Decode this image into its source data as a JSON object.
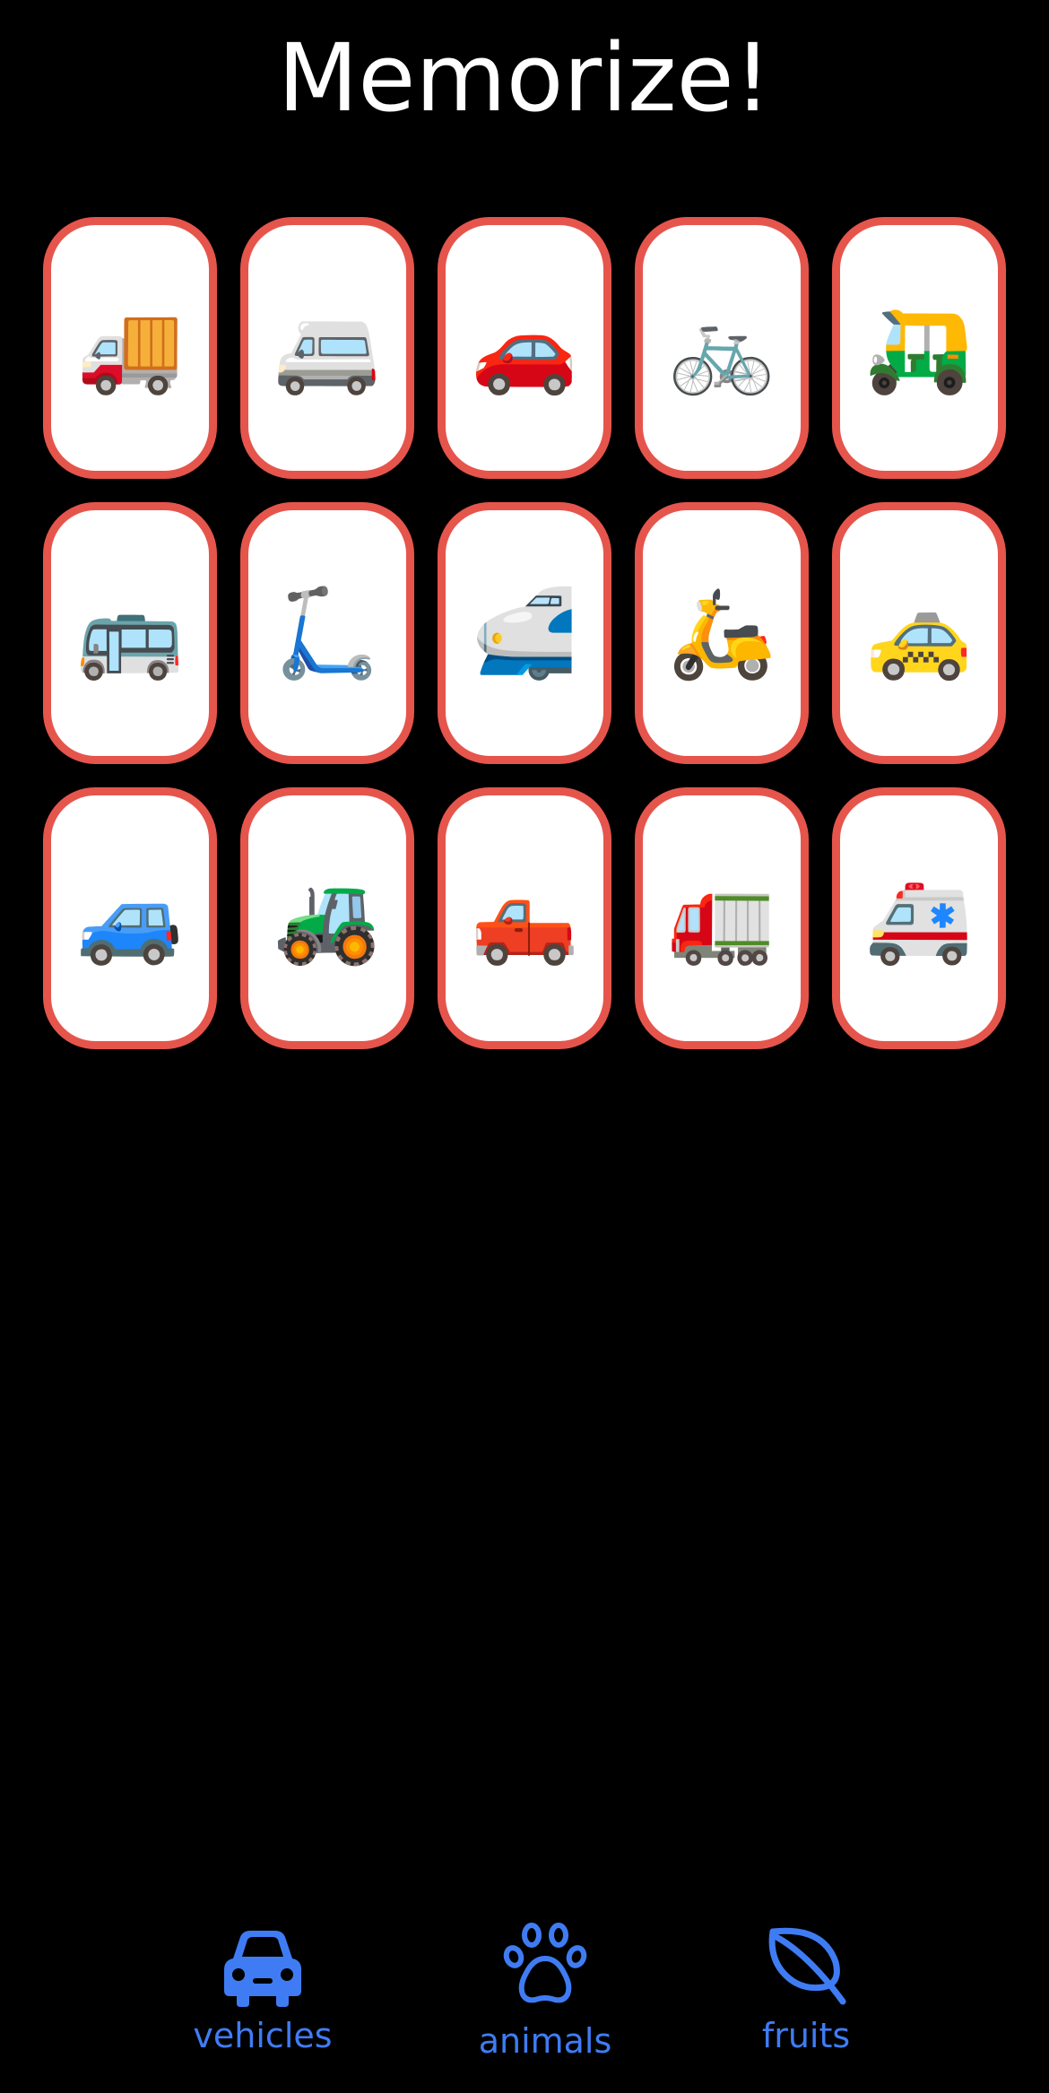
{
  "app": {
    "title": "Memorize!"
  },
  "cards": [
    {
      "emoji": "🚚",
      "icon": "delivery-truck"
    },
    {
      "emoji": "🚐",
      "icon": "minibus"
    },
    {
      "emoji": "🚗",
      "icon": "red-car"
    },
    {
      "emoji": "🚲",
      "icon": "bicycle"
    },
    {
      "emoji": "🛺",
      "icon": "auto-rickshaw"
    },
    {
      "emoji": "🚌",
      "icon": "bus"
    },
    {
      "emoji": "🛴",
      "icon": "kick-scooter"
    },
    {
      "emoji": "🚅",
      "icon": "bullet-train"
    },
    {
      "emoji": "🛵",
      "icon": "motor-scooter"
    },
    {
      "emoji": "🚕",
      "icon": "taxi"
    },
    {
      "emoji": "🚙",
      "icon": "blue-suv"
    },
    {
      "emoji": "🚜",
      "icon": "tractor"
    },
    {
      "emoji": "🛻",
      "icon": "pickup-truck"
    },
    {
      "emoji": "🚛",
      "icon": "articulated-lorry"
    },
    {
      "emoji": "🚑",
      "icon": "ambulance"
    }
  ],
  "tabs": [
    {
      "label": "vehicles",
      "icon": "car-icon"
    },
    {
      "label": "animals",
      "icon": "paw-icon"
    },
    {
      "label": "fruits",
      "icon": "leaf-icon"
    }
  ],
  "colors": {
    "background": "#000000",
    "card_border": "#e5554c",
    "card_face": "#ffffff",
    "accent": "#3f7cf4",
    "title": "#ffffff"
  }
}
